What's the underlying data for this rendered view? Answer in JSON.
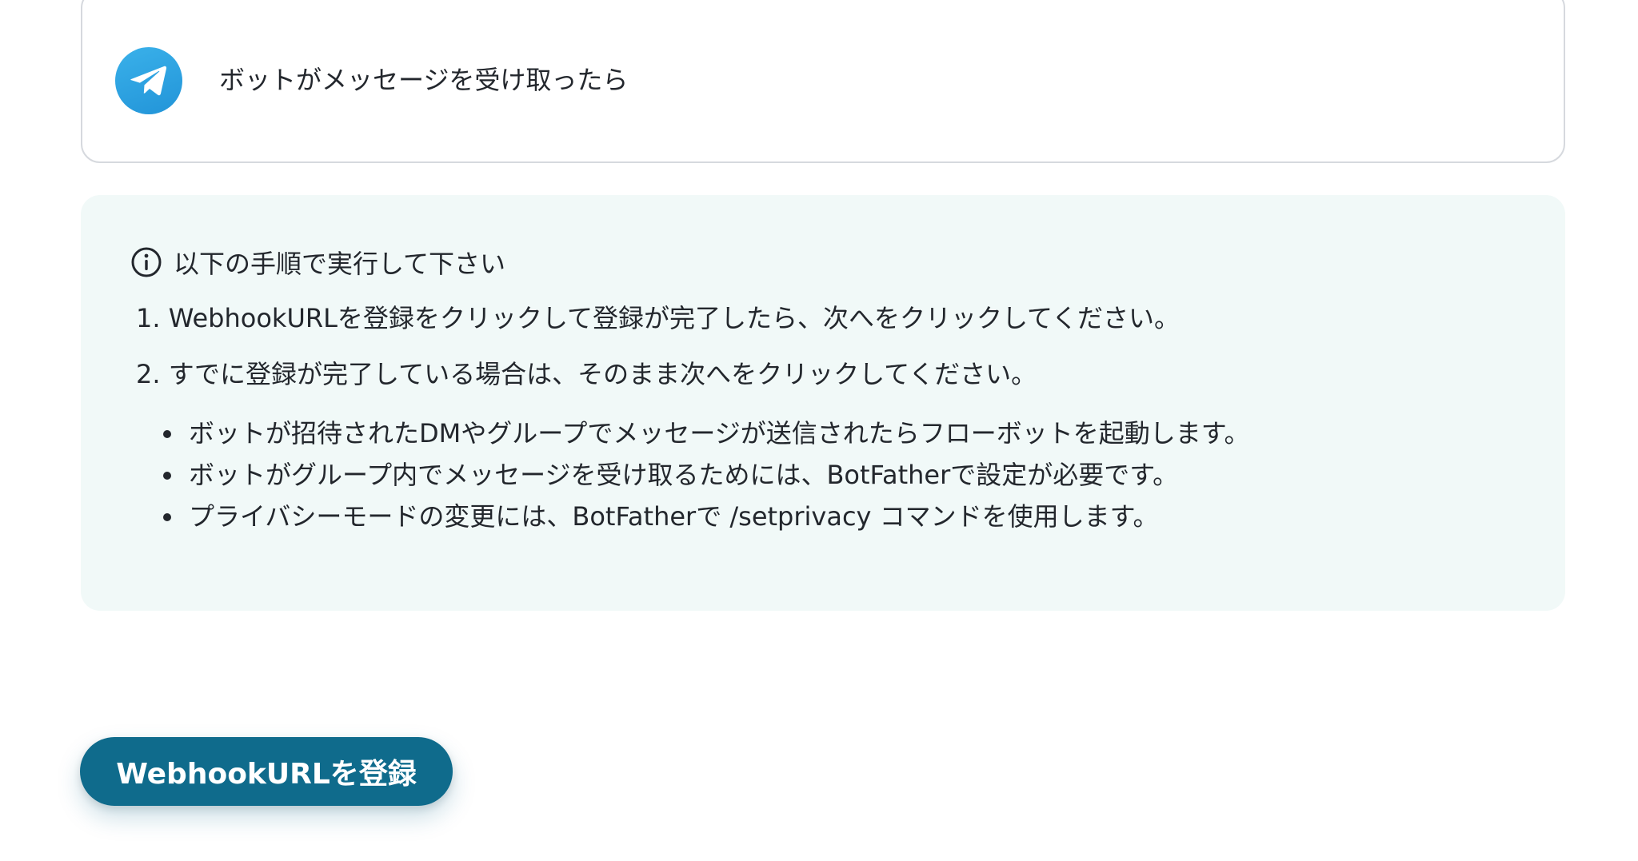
{
  "trigger": {
    "app_icon": "telegram-icon",
    "label": "ボットがメッセージを受け取ったら"
  },
  "info": {
    "icon": "info-circle-icon",
    "heading": "以下の手順で実行して下さい",
    "steps": [
      "1. WebhookURLを登録をクリックして登録が完了したら、次へをクリックしてください。",
      "2. すでに登録が完了している場合は、そのまま次へをクリックしてください。"
    ],
    "notes": [
      "ボットが招待されたDMやグループでメッセージが送信されたらフローボットを起動します。",
      "ボットがグループ内でメッセージを受け取るためには、BotFatherで設定が必要です。",
      "プライバシーモードの変更には、BotFatherで /setprivacy コマンドを使用します。"
    ]
  },
  "actions": {
    "register_label": "WebhookURLを登録"
  },
  "colors": {
    "accent": "#0f6b8c",
    "telegram": "#2aa3e0",
    "info_bg": "#f1f9f8"
  }
}
